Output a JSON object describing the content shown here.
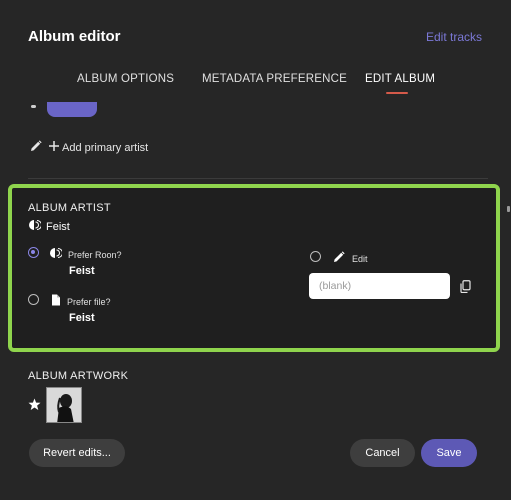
{
  "header": {
    "title": "Album editor",
    "edit_tracks_label": "Edit tracks"
  },
  "tabs": [
    {
      "label": "ALBUM OPTIONS"
    },
    {
      "label": "METADATA PREFERENCE"
    },
    {
      "label": "EDIT ALBUM",
      "active": true
    }
  ],
  "add_primary_artist_label": "Add primary artist",
  "album_artist": {
    "section_label": "ALBUM ARTIST",
    "current_value": "Feist",
    "options": [
      {
        "label": "Prefer Roon?",
        "value": "Feist",
        "selected": true
      },
      {
        "label": "Prefer file?",
        "value": "Feist",
        "selected": false
      }
    ],
    "edit": {
      "label": "Edit",
      "selected": false,
      "input_value": "",
      "placeholder": "(blank)"
    }
  },
  "album_artwork": {
    "section_label": "ALBUM ARTWORK"
  },
  "footer": {
    "revert_label": "Revert edits...",
    "cancel_label": "Cancel",
    "save_label": "Save"
  },
  "colors": {
    "accent": "#5d59b5",
    "highlight_border": "#8fd44d",
    "tab_underline": "#d45a4a",
    "link": "#7b78d6"
  },
  "icons": [
    "pencil-icon",
    "plus-icon",
    "roon-icon",
    "file-icon",
    "copy-icon",
    "star-icon"
  ]
}
